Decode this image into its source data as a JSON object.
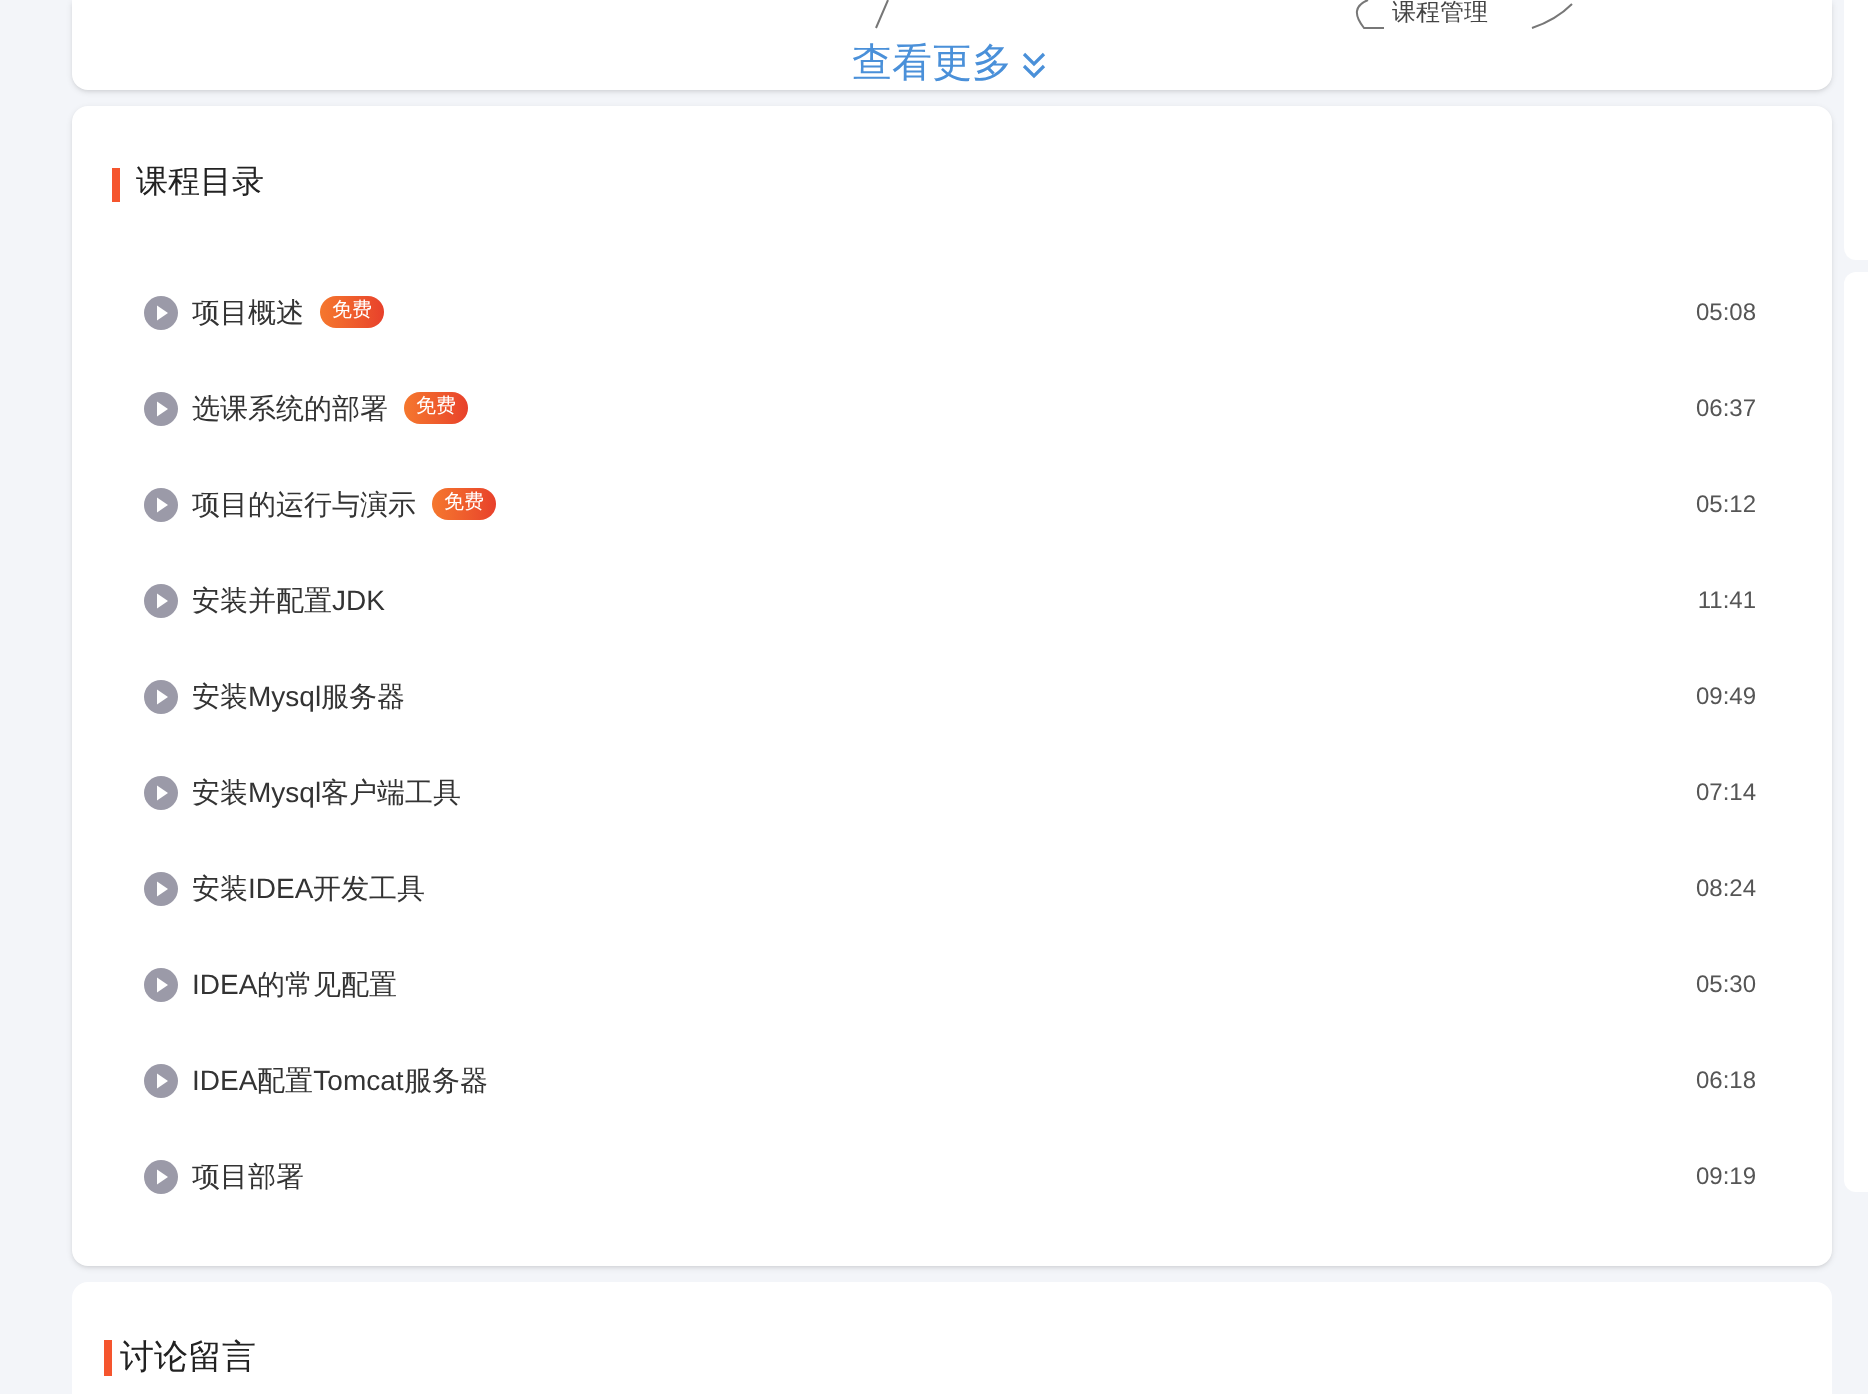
{
  "mindmap": {
    "node_label": "课程管理"
  },
  "more_link": {
    "label": "查看更多"
  },
  "catalog": {
    "title": "课程目录",
    "lessons": [
      {
        "title": "项目概述",
        "badge": "免费",
        "duration": "05:08"
      },
      {
        "title": "选课系统的部署",
        "badge": "免费",
        "duration": "06:37"
      },
      {
        "title": "项目的运行与演示",
        "badge": "免费",
        "duration": "05:12"
      },
      {
        "title": "安装并配置JDK",
        "duration": "11:41"
      },
      {
        "title": "安装Mysql服务器",
        "duration": "09:49"
      },
      {
        "title": "安装Mysql客户端工具",
        "duration": "07:14"
      },
      {
        "title": "安装IDEA开发工具",
        "duration": "08:24"
      },
      {
        "title": "IDEA的常见配置",
        "duration": "05:30"
      },
      {
        "title": "IDEA配置Tomcat服务器",
        "duration": "06:18"
      },
      {
        "title": "项目部署",
        "duration": "09:19"
      }
    ]
  },
  "discussion": {
    "title": "讨论留言"
  }
}
